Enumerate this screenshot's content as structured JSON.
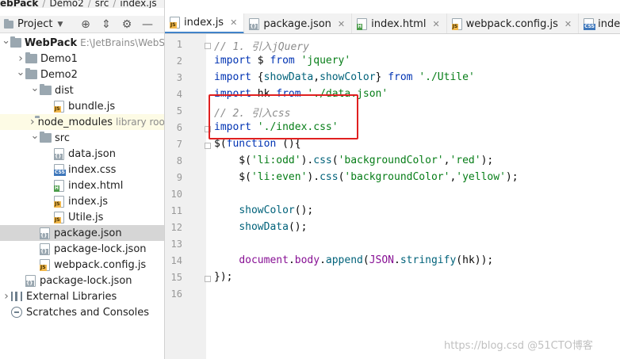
{
  "breadcrumb": [
    "ebPack",
    "Demo2",
    "src",
    "index.js"
  ],
  "project_panel": {
    "title": "Project",
    "tree": [
      {
        "label": "WebPack",
        "extra": "E:\\JetBrains\\WebS",
        "type": "folder",
        "depth": 0,
        "expanded": true
      },
      {
        "label": "Demo1",
        "type": "folder",
        "depth": 1,
        "expanded": false
      },
      {
        "label": "Demo2",
        "type": "folder",
        "depth": 1,
        "expanded": true
      },
      {
        "label": "dist",
        "type": "folder",
        "depth": 2,
        "expanded": true
      },
      {
        "label": "bundle.js",
        "type": "js",
        "depth": 3
      },
      {
        "label": "node_modules",
        "extra": "library root",
        "type": "folder",
        "depth": 2,
        "expanded": false
      },
      {
        "label": "src",
        "type": "folder",
        "depth": 2,
        "expanded": true
      },
      {
        "label": "data.json",
        "type": "json",
        "depth": 3
      },
      {
        "label": "index.css",
        "type": "css",
        "depth": 3
      },
      {
        "label": "index.html",
        "type": "html",
        "depth": 3
      },
      {
        "label": "index.js",
        "type": "js",
        "depth": 3
      },
      {
        "label": "Utile.js",
        "type": "js",
        "depth": 3
      },
      {
        "label": "package.json",
        "type": "json",
        "depth": 2
      },
      {
        "label": "package-lock.json",
        "type": "json",
        "depth": 2
      },
      {
        "label": "webpack.config.js",
        "type": "js",
        "depth": 2
      },
      {
        "label": "package-lock.json",
        "type": "json",
        "depth": 1
      },
      {
        "label": "External Libraries",
        "type": "lib",
        "depth": 0,
        "expanded": false
      },
      {
        "label": "Scratches and Consoles",
        "type": "scratch",
        "depth": 0
      }
    ]
  },
  "tabs": [
    {
      "label": "index.js",
      "type": "js",
      "active": true
    },
    {
      "label": "package.json",
      "type": "json",
      "active": false
    },
    {
      "label": "index.html",
      "type": "html",
      "active": false
    },
    {
      "label": "webpack.config.js",
      "type": "js",
      "active": false
    },
    {
      "label": "index.css",
      "type": "css",
      "active": false
    }
  ],
  "code_lines": [
    "// 1. 引入jQuery",
    "import $ from 'jquery'",
    "import {showData,showColor} from './Utile'",
    "import hk from './data.json'",
    "// 2. 引入css",
    "import './index.css'",
    "$(function (){",
    "    $('li:odd').css('backgroundColor','red');",
    "    $('li:even').css('backgroundColor','yellow');",
    "",
    "    showColor();",
    "    showData();",
    "",
    "    document.body.append(JSON.stringify(hk));",
    "});",
    ""
  ],
  "watermark": "https://blog.csd @51CTO博客"
}
